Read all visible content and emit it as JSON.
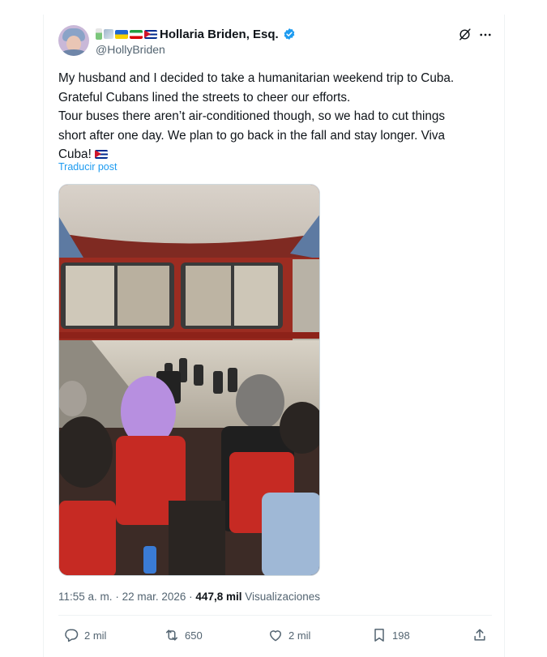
{
  "author": {
    "display_name": "Hollaria Briden, Esq.",
    "handle": "@HollyBriden",
    "verified": true,
    "name_emojis": [
      "syringe",
      "vaccine",
      "flag-ukraine",
      "flag-iran",
      "flag-cuba"
    ]
  },
  "header_icons": [
    "grok-icon",
    "more-icon"
  ],
  "post": {
    "lines": [
      "My husband and I decided to take a humanitarian weekend trip to Cuba.",
      "Grateful Cubans lined the streets to cheer our efforts.",
      "Tour buses there aren’t air-conditioned though, so we had to cut things",
      "short after one day. We plan to go back in the fall and stay longer. Viva",
      "Cuba!"
    ],
    "trailing_emoji": "flag-cuba",
    "translate_label": "Traducir post"
  },
  "media": {
    "description_icon": "photo-tour-bus-interior"
  },
  "meta": {
    "time": "11:55 a. m.",
    "separator": "·",
    "date": "22 mar. 2026",
    "views_count": "447,8 mil",
    "views_label": "Visualizaciones"
  },
  "actions": {
    "reply": "2 mil",
    "repost": "650",
    "like": "2 mil",
    "bookmark": "198"
  },
  "colors": {
    "accent": "#1d9bf0",
    "secondary_text": "#536471",
    "primary_text": "#0f1419"
  }
}
